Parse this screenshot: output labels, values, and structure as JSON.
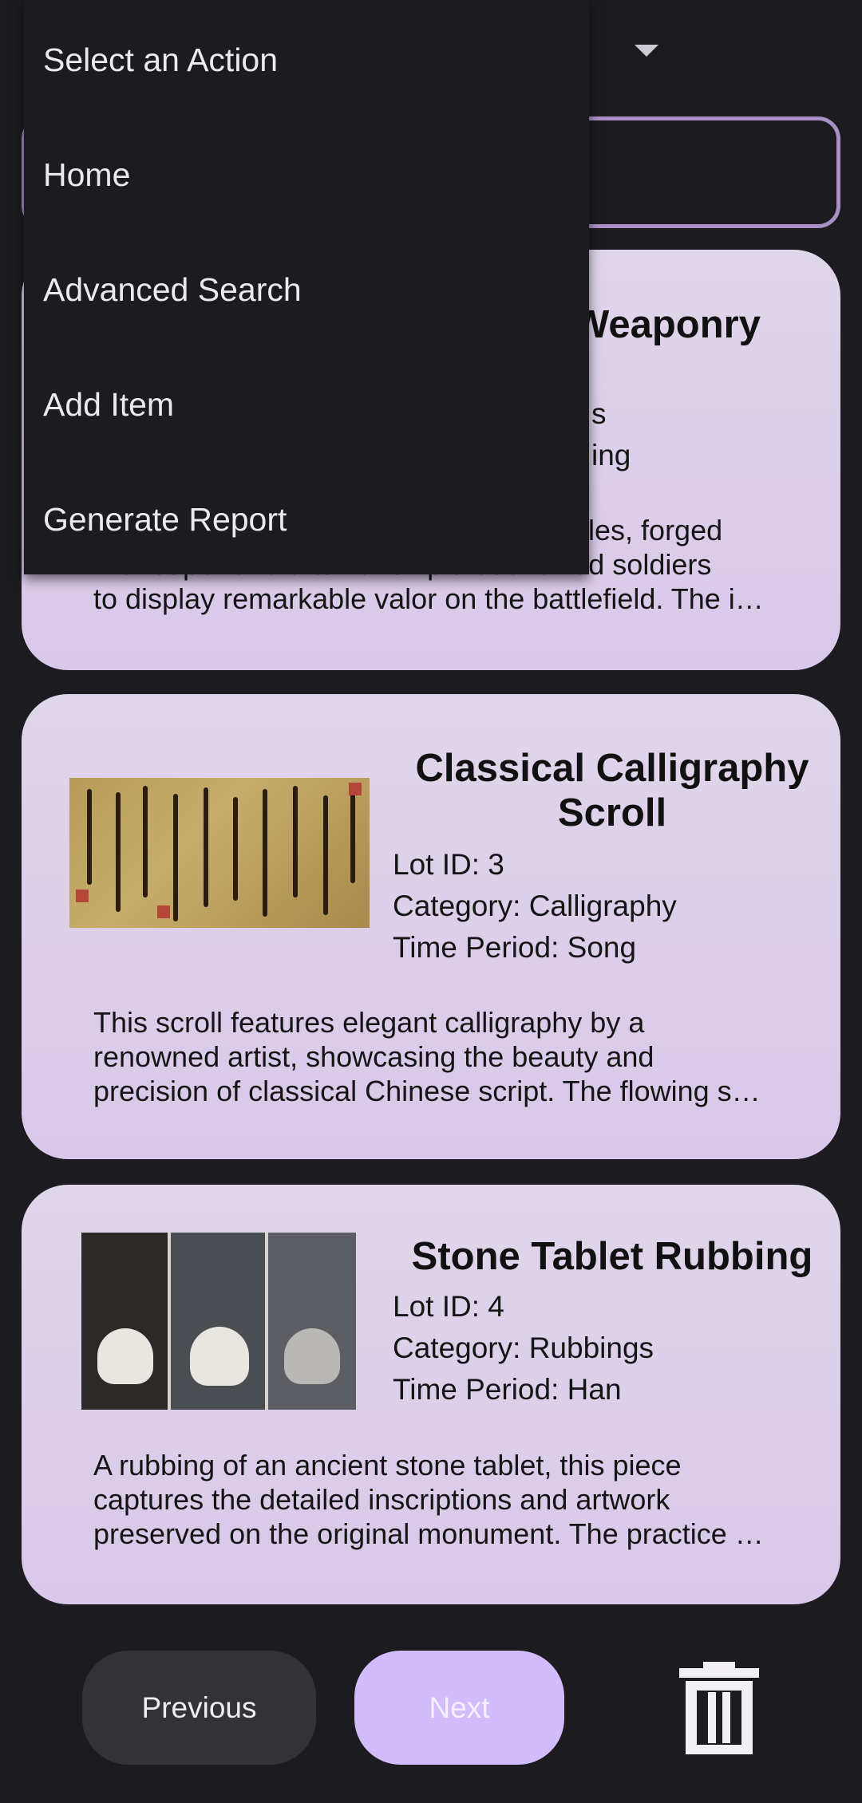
{
  "dropdown": {
    "items": [
      {
        "label": "Select an Action"
      },
      {
        "label": "Home"
      },
      {
        "label": "Advanced Search"
      },
      {
        "label": "Add Item"
      },
      {
        "label": "Generate Report"
      }
    ]
  },
  "header": {
    "dropdown_icon": "chevron-down-icon"
  },
  "cards": [
    {
      "title_visible": "Weaponry",
      "meta_line1_tail": "s",
      "meta_line2_tail": "ing",
      "desc_lines": [
        "attles, forged",
        "with superior craftsmanship that allowed soldiers",
        "to display remarkable valor on the battlefield. The i…"
      ]
    },
    {
      "title": "Classical Calligraphy Scroll",
      "lot": "Lot ID: 3",
      "category": "Category: Calligraphy",
      "period": "Time Period: Song",
      "desc_lines": [
        "This scroll features elegant calligraphy by a",
        "renowned artist, showcasing the beauty and",
        "precision of classical Chinese script. The flowing s…"
      ],
      "image_icon": "calligraphy-scroll-image"
    },
    {
      "title": "Stone Tablet Rubbing",
      "lot": "Lot ID: 4",
      "category": "Category: Rubbings",
      "period": "Time Period: Han",
      "desc_lines": [
        "A rubbing of an ancient stone tablet, this piece",
        "captures the detailed inscriptions and artwork",
        "preserved on the original monument. The practice …"
      ],
      "image_icon": "stone-rubbing-image"
    }
  ],
  "footer": {
    "previous_label": "Previous",
    "next_label": "Next",
    "delete_icon": "trash-icon"
  },
  "colors": {
    "background": "#1c1b20",
    "card": "#dccfea",
    "accent": "#d3bcfb",
    "outline": "#a98fc7"
  }
}
